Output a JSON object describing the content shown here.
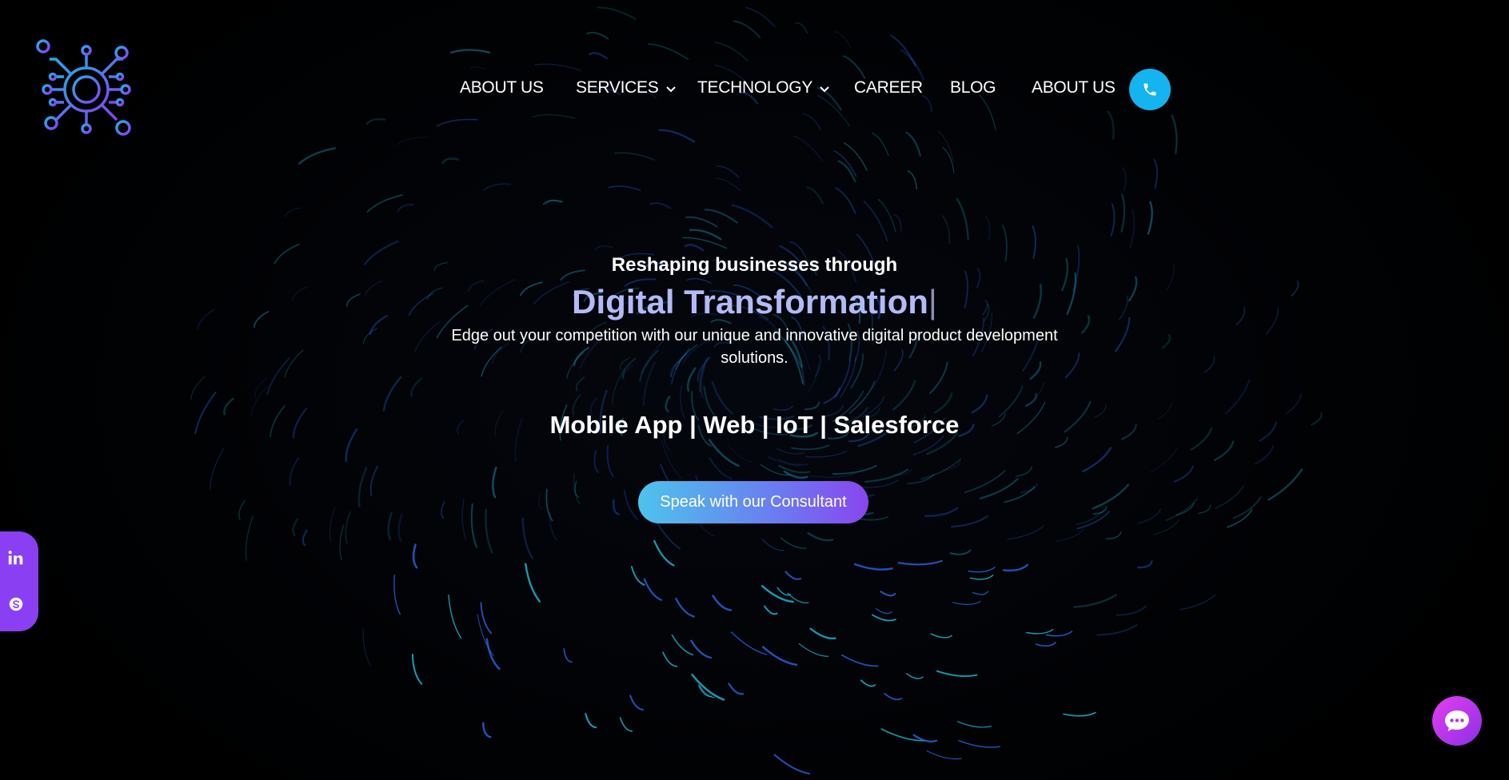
{
  "nav": {
    "items": [
      {
        "label": "ABOUT US",
        "dropdown": false
      },
      {
        "label": "SERVICES",
        "dropdown": true
      },
      {
        "label": "TECHNOLOGY",
        "dropdown": true
      },
      {
        "label": "CAREER",
        "dropdown": false
      },
      {
        "label": "BLOG",
        "dropdown": false
      },
      {
        "label": "ABOUT US",
        "dropdown": false
      }
    ],
    "phone_icon": "phone-icon"
  },
  "hero": {
    "kicker": "Reshaping businesses through",
    "title": "Digital Transformation",
    "cursor": "|",
    "description": "Edge out your competition with our unique and innovative digital product development solutions.",
    "services": "Mobile App | Web | IoT | Salesforce",
    "cta_label": "Speak with our Consultant"
  },
  "social": {
    "items": [
      "linkedin-icon",
      "skype-icon"
    ]
  },
  "chat": {
    "icon": "chat-bubble-icon"
  },
  "colors": {
    "accent_blue": "#13b4f0",
    "accent_purple": "#8a3ff2",
    "title_lavender": "#b3bbf6",
    "chat_magenta": "#e63ff0"
  }
}
